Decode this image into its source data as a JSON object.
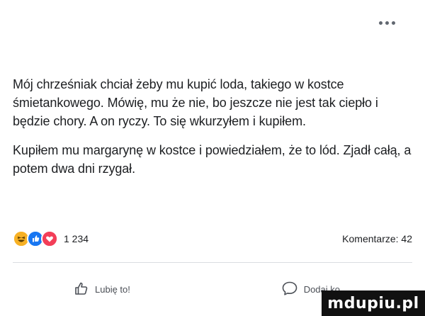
{
  "header": {
    "more_icon": "more-horizontal-icon"
  },
  "post": {
    "paragraphs": [
      "Mój chrześniak chciał żeby mu kupić loda, takiego w kostce śmietankowego. Mówię, mu że nie, bo jeszcze nie jest tak ciepło i będzie chory. A on ryczy. To się wkurzyłem i kupiłem.",
      "Kupiłem mu margarynę w kostce i powiedziałem, że to lód. Zjadł całą, a potem dwa dni rzygał."
    ]
  },
  "reactions": {
    "icons": [
      "haha-icon",
      "like-icon",
      "love-icon"
    ],
    "count": "1 234",
    "comments": "Komentarze: 42",
    "colors": {
      "haha": "#f7b125",
      "like": "#1877f2",
      "love": "#f33e58"
    }
  },
  "actions": {
    "like_label": "Lubię to!",
    "comment_label": "Dodaj ko",
    "like_icon": "thumbs-up-outline-icon",
    "comment_icon": "comment-bubble-icon"
  },
  "watermark": {
    "text": "mdupiu.pl"
  }
}
